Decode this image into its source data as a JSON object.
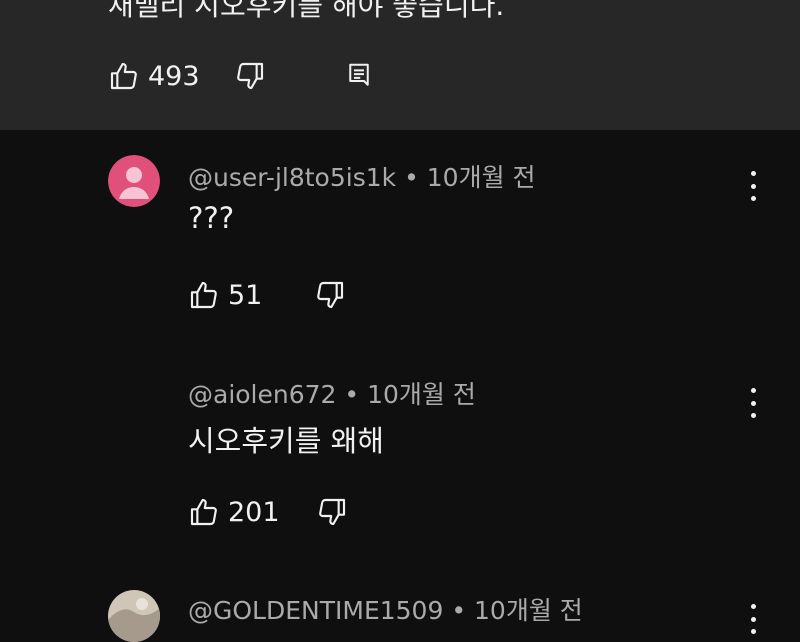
{
  "top_comment": {
    "text": "재밸리 시오후키를 해야 좋습니다.",
    "like_count": "493"
  },
  "replies": [
    {
      "author": "@user-jl8to5is1k",
      "time": "10개월 전",
      "text": "???",
      "like_count": "51",
      "avatar_color": "#e0507a"
    },
    {
      "author": "@aiolen672",
      "time": "10개월 전",
      "text": "시오후키를 왜해",
      "like_count": "201",
      "avatar_color": "#0f0f0f"
    },
    {
      "author": "@GOLDENTIME1509",
      "time": "10개월 전",
      "text": "",
      "like_count": "",
      "avatar_color": "#cfc6b8"
    }
  ],
  "meta_separator": "•"
}
